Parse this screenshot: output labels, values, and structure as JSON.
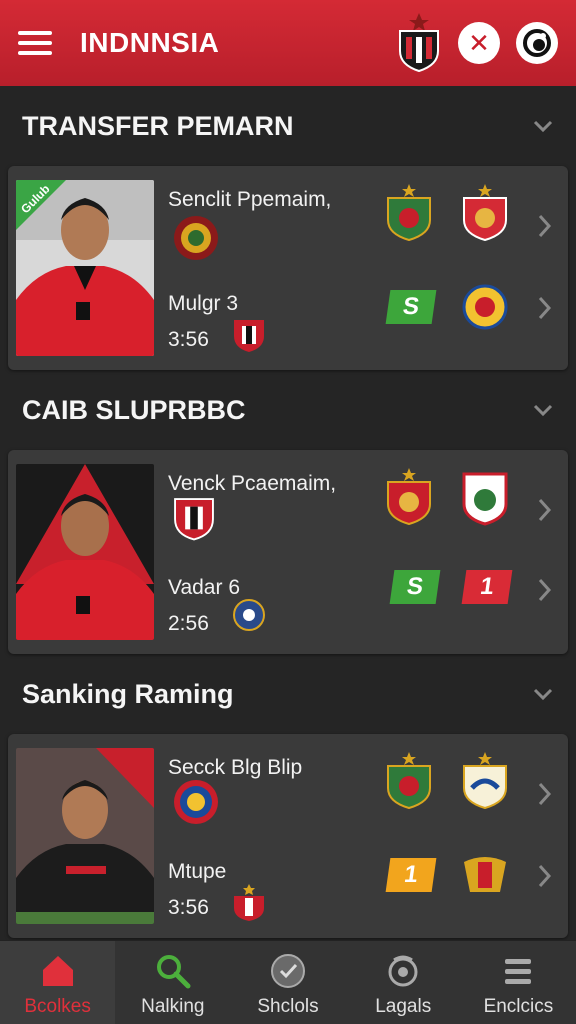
{
  "header": {
    "title": "INDNNSIA",
    "menu_icon": "hamburger-icon",
    "close_icon": "close-icon",
    "refresh_icon": "refresh-icon"
  },
  "sections": [
    {
      "title": "TRANSFER PEMARN",
      "photo_tag": "Gulub",
      "line1": "Senclit Ppemaim,",
      "line2": "Mulgr 3",
      "line3": "3:56",
      "score_top": "",
      "score_a": "S",
      "score_a_color": "#3da63b",
      "score_b": ""
    },
    {
      "title": "CAIB SLUPRBBC",
      "photo_tag": "",
      "line1": "Venck Pcaemaim,",
      "line2": "Vadar 6",
      "line3": "2:56",
      "score_a": "S",
      "score_a_color": "#3da63b",
      "score_b": "1",
      "score_b_color": "#d92b36"
    },
    {
      "title": "Sanking Raming",
      "photo_tag": "",
      "line1": "Secck Blg Blip",
      "line2": "Mtupe",
      "line3": "3:56",
      "score_a": "1",
      "score_a_color": "#f2a51d",
      "score_b": ""
    }
  ],
  "nav": [
    {
      "label": "Bcolkes",
      "icon": "home-icon",
      "active": true
    },
    {
      "label": "Nalking",
      "icon": "search-icon",
      "active": false
    },
    {
      "label": "Shclols",
      "icon": "clock-icon",
      "active": false
    },
    {
      "label": "Lagals",
      "icon": "globe-icon",
      "active": false
    },
    {
      "label": "Enclcics",
      "icon": "menu-icon",
      "active": false
    }
  ],
  "colors": {
    "header": "#c8232f",
    "accent_red": "#d92b36",
    "accent_green": "#3da63b",
    "accent_yellow": "#f2a51d"
  }
}
